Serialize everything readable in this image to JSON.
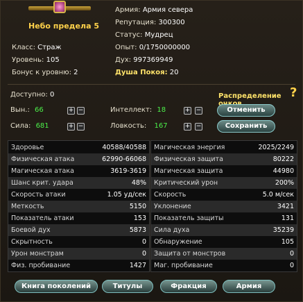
{
  "header": {
    "character_name": "Небо предела 5",
    "left": [
      {
        "label": "Класс:",
        "value": "Страж"
      },
      {
        "label": "Уровень:",
        "value": "105"
      },
      {
        "label": "Бонус к уровню:",
        "value": "2"
      }
    ],
    "right": [
      {
        "label": "Армия:",
        "value": "Армия севера"
      },
      {
        "label": "Репутация:",
        "value": "300300"
      },
      {
        "label": "Статус:",
        "value": "Мудрец"
      },
      {
        "label": "Опыт:",
        "value": "0/1750000000"
      },
      {
        "label": "Дух:",
        "value": "997369949"
      },
      {
        "label": "Душа Покоя:",
        "value": "20"
      }
    ]
  },
  "points": {
    "available_label": "Доступно:",
    "available_value": "0",
    "distribution_label": "Распределение очков",
    "help_symbol": "?",
    "stats": [
      {
        "label": "Вын.:",
        "value": "66"
      },
      {
        "label": "Сила:",
        "value": "681"
      },
      {
        "label": "Интеллект:",
        "value": "18"
      },
      {
        "label": "Ловкость:",
        "value": "167"
      }
    ],
    "plus": "+",
    "minus": "−",
    "cancel_button": "Отменить",
    "save_button": "Сохранить"
  },
  "stats_left": [
    {
      "name": "Здоровье",
      "value": "40588/40588"
    },
    {
      "name": "Физическая атака",
      "value": "62990-66068"
    },
    {
      "name": "Магическая атака",
      "value": "3619-3619"
    },
    {
      "name": "Шанс крит. удара",
      "value": "48%"
    },
    {
      "name": "Скорость атаки",
      "value": "1.05 уд/сек"
    },
    {
      "name": "Меткость",
      "value": "5150"
    },
    {
      "name": "Показатель атаки",
      "value": "153"
    },
    {
      "name": "Боевой дух",
      "value": "5873"
    },
    {
      "name": "Скрытность",
      "value": "0"
    },
    {
      "name": "Урон монстрам",
      "value": "0"
    },
    {
      "name": "Физ. пробивание",
      "value": "1427"
    }
  ],
  "stats_right": [
    {
      "name": "Магическая энергия",
      "value": "2025/2249"
    },
    {
      "name": "Физическая защита",
      "value": "80222"
    },
    {
      "name": "Магическая защита",
      "value": "44980"
    },
    {
      "name": "Критический урон",
      "value": "200%"
    },
    {
      "name": "Скорость",
      "value": "5.0 м/сек"
    },
    {
      "name": "Уклонение",
      "value": "3421"
    },
    {
      "name": "Показатель защиты",
      "value": "131"
    },
    {
      "name": "Сила духа",
      "value": "35239"
    },
    {
      "name": "Обнаружение",
      "value": "105"
    },
    {
      "name": "Защита от монстров",
      "value": "0"
    },
    {
      "name": "Маг. пробивание",
      "value": "0"
    }
  ],
  "tabs": [
    "Книга поколений",
    "Титулы",
    "Фракция",
    "Армия"
  ]
}
